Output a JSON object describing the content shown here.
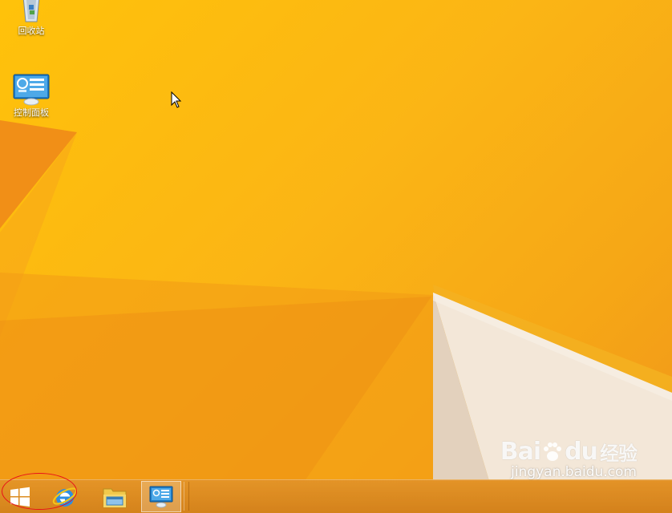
{
  "desktop": {
    "icons": [
      {
        "label": "回收站",
        "icon": "recycle-bin-icon"
      },
      {
        "label": "控制面板",
        "icon": "control-panel-icon"
      }
    ]
  },
  "taskbar": {
    "items": [
      {
        "name": "start",
        "icon": "windows-logo-icon"
      },
      {
        "name": "internet-explorer",
        "icon": "ie-icon"
      },
      {
        "name": "file-explorer",
        "icon": "folder-icon"
      },
      {
        "name": "control-panel",
        "icon": "control-panel-icon",
        "active": true
      }
    ]
  },
  "annotation": {
    "color": "#e8101a",
    "shape": "ellipse around start button"
  },
  "watermark": {
    "brand_left": "Bai",
    "brand_right": "du",
    "brand_cn": "经验",
    "site": "jingyan.baidu.com"
  },
  "colors": {
    "wallpaper": "#fbb515",
    "wallpaper_light": "#f4e9dc",
    "taskbar": "#e09028",
    "annotation": "#e8101a"
  }
}
